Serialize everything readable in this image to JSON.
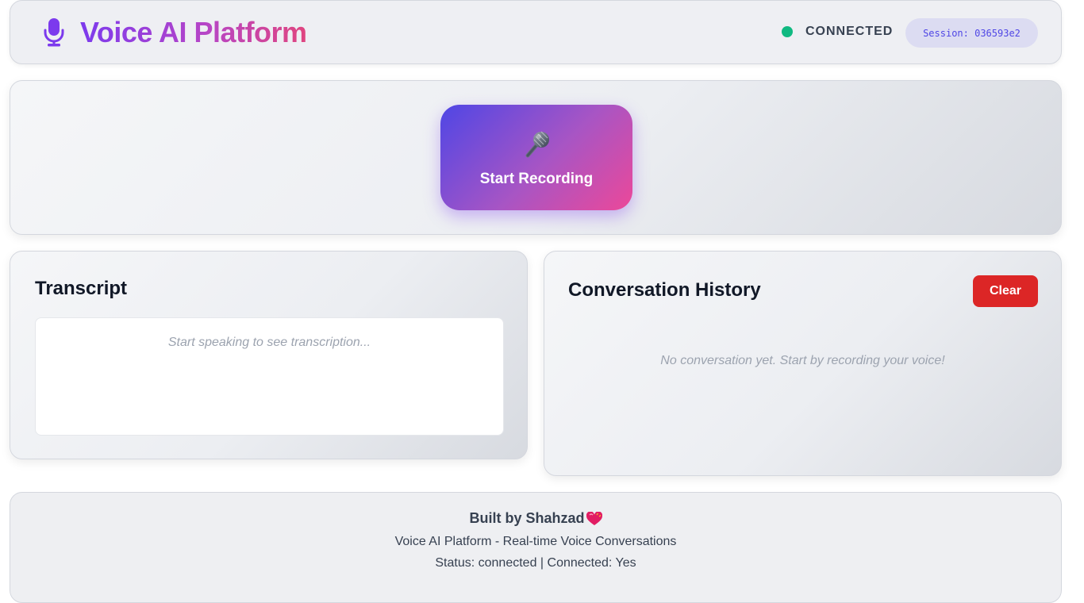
{
  "header": {
    "title": "Voice AI Platform",
    "icon": "microphone-icon",
    "status": "CONNECTED",
    "status_color": "#10b981",
    "session": "Session: 036593e2"
  },
  "record": {
    "icon": "microphone-icon",
    "label": "Start Recording"
  },
  "transcript": {
    "title": "Transcript",
    "placeholder": "Start speaking to see transcription..."
  },
  "history": {
    "title": "Conversation History",
    "clear_label": "Clear",
    "empty_text": "No conversation yet. Start by recording your voice!"
  },
  "footer": {
    "credit": "Built by Shahzad",
    "subtitle": "Voice AI Platform - Real-time Voice Conversations",
    "status_line": "Status: connected | Connected: Yes"
  },
  "colors": {
    "accent": "#7c3aed",
    "accent_pink": "#ec4899",
    "danger": "#dc2626"
  }
}
